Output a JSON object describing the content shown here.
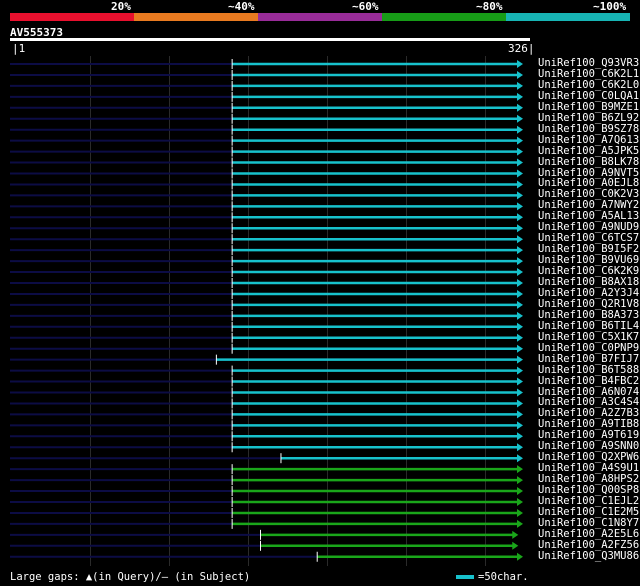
{
  "legend": {
    "items": [
      {
        "label": "20%",
        "color": "#e8102e"
      },
      {
        "label": "~40%",
        "color": "#e87a20"
      },
      {
        "label": "~60%",
        "color": "#992c99"
      },
      {
        "label": "~80%",
        "color": "#179c17"
      },
      {
        "label": "~100%",
        "color": "#17b4b4"
      }
    ]
  },
  "query": {
    "name": "AV555373",
    "start": "1",
    "end": "326"
  },
  "colors": {
    "cyan": "#17c1cc",
    "green": "#1aa61a",
    "dim": "#0c0c45"
  },
  "hits": [
    {
      "id": "UniRef100_Q93VR3",
      "start": 142,
      "end": 326,
      "color": "cyan"
    },
    {
      "id": "UniRef100_C6K2L1",
      "start": 142,
      "end": 326,
      "color": "cyan"
    },
    {
      "id": "UniRef100_C6K2L0",
      "start": 142,
      "end": 326,
      "color": "cyan"
    },
    {
      "id": "UniRef100_C0LQA1",
      "start": 142,
      "end": 326,
      "color": "cyan"
    },
    {
      "id": "UniRef100_B9MZE1",
      "start": 142,
      "end": 326,
      "color": "cyan"
    },
    {
      "id": "UniRef100_B6ZL92",
      "start": 142,
      "end": 326,
      "color": "cyan"
    },
    {
      "id": "UniRef100_B9SZ78",
      "start": 142,
      "end": 326,
      "color": "cyan"
    },
    {
      "id": "UniRef100_A7Q613",
      "start": 142,
      "end": 326,
      "color": "cyan"
    },
    {
      "id": "UniRef100_A5JPK5",
      "start": 142,
      "end": 326,
      "color": "cyan"
    },
    {
      "id": "UniRef100_B8LK78",
      "start": 142,
      "end": 326,
      "color": "cyan"
    },
    {
      "id": "UniRef100_A9NVT5",
      "start": 142,
      "end": 326,
      "color": "cyan"
    },
    {
      "id": "UniRef100_A0EJL8",
      "start": 142,
      "end": 326,
      "color": "cyan"
    },
    {
      "id": "UniRef100_C0K2V3",
      "start": 142,
      "end": 326,
      "color": "cyan"
    },
    {
      "id": "UniRef100_A7NWY2",
      "start": 142,
      "end": 326,
      "color": "cyan"
    },
    {
      "id": "UniRef100_A5AL13",
      "start": 142,
      "end": 326,
      "color": "cyan"
    },
    {
      "id": "UniRef100_A9NUD9",
      "start": 142,
      "end": 326,
      "color": "cyan"
    },
    {
      "id": "UniRef100_C6TCS7",
      "start": 142,
      "end": 326,
      "color": "cyan"
    },
    {
      "id": "UniRef100_B9I5F2",
      "start": 142,
      "end": 326,
      "color": "cyan"
    },
    {
      "id": "UniRef100_B9VU69",
      "start": 142,
      "end": 326,
      "color": "cyan"
    },
    {
      "id": "UniRef100_C6K2K9",
      "start": 142,
      "end": 326,
      "color": "cyan"
    },
    {
      "id": "UniRef100_B8AX18",
      "start": 142,
      "end": 326,
      "color": "cyan"
    },
    {
      "id": "UniRef100_A2Y3J4",
      "start": 142,
      "end": 326,
      "color": "cyan"
    },
    {
      "id": "UniRef100_Q2R1V8",
      "start": 142,
      "end": 326,
      "color": "cyan"
    },
    {
      "id": "UniRef100_B8A373",
      "start": 142,
      "end": 326,
      "color": "cyan"
    },
    {
      "id": "UniRef100_B6TIL4",
      "start": 142,
      "end": 326,
      "color": "cyan"
    },
    {
      "id": "UniRef100_C5X1K7",
      "start": 142,
      "end": 326,
      "color": "cyan"
    },
    {
      "id": "UniRef100_C0PNP9",
      "start": 142,
      "end": 326,
      "color": "cyan"
    },
    {
      "id": "UniRef100_B7FIJ7",
      "start": 132,
      "end": 326,
      "color": "cyan"
    },
    {
      "id": "UniRef100_B6T588",
      "start": 142,
      "end": 326,
      "color": "cyan"
    },
    {
      "id": "UniRef100_B4FBC2",
      "start": 142,
      "end": 326,
      "color": "cyan"
    },
    {
      "id": "UniRef100_A6N074",
      "start": 142,
      "end": 326,
      "color": "cyan"
    },
    {
      "id": "UniRef100_A3C4S4",
      "start": 142,
      "end": 326,
      "color": "cyan"
    },
    {
      "id": "UniRef100_A2Z7B3",
      "start": 142,
      "end": 326,
      "color": "cyan"
    },
    {
      "id": "UniRef100_A9TIB8",
      "start": 142,
      "end": 326,
      "color": "cyan"
    },
    {
      "id": "UniRef100_A9T619",
      "start": 142,
      "end": 326,
      "color": "cyan"
    },
    {
      "id": "UniRef100_A9SNN0",
      "start": 142,
      "end": 326,
      "color": "cyan"
    },
    {
      "id": "UniRef100_Q2XPW6",
      "start": 173,
      "end": 326,
      "color": "cyan"
    },
    {
      "id": "UniRef100_A4S9U1",
      "start": 142,
      "end": 326,
      "color": "green"
    },
    {
      "id": "UniRef100_A8HPS2",
      "start": 142,
      "end": 326,
      "color": "green"
    },
    {
      "id": "UniRef100_Q00SP8",
      "start": 142,
      "end": 326,
      "color": "green"
    },
    {
      "id": "UniRef100_C1EJL2",
      "start": 142,
      "end": 326,
      "color": "green"
    },
    {
      "id": "UniRef100_C1E2M5",
      "start": 142,
      "end": 326,
      "color": "green"
    },
    {
      "id": "UniRef100_C1N8Y7",
      "start": 142,
      "end": 326,
      "color": "green"
    },
    {
      "id": "UniRef100_A2E5L6",
      "start": 160,
      "end": 323,
      "color": "green"
    },
    {
      "id": "UniRef100_A2FZ56",
      "start": 160,
      "end": 323,
      "color": "green"
    },
    {
      "id": "UniRef100_Q3MU86",
      "start": 196,
      "end": 326,
      "color": "green"
    }
  ],
  "footer": {
    "gaps_text": "Large gaps: ▲(in Query)/– (in Subject)",
    "key_text": "=50char."
  }
}
